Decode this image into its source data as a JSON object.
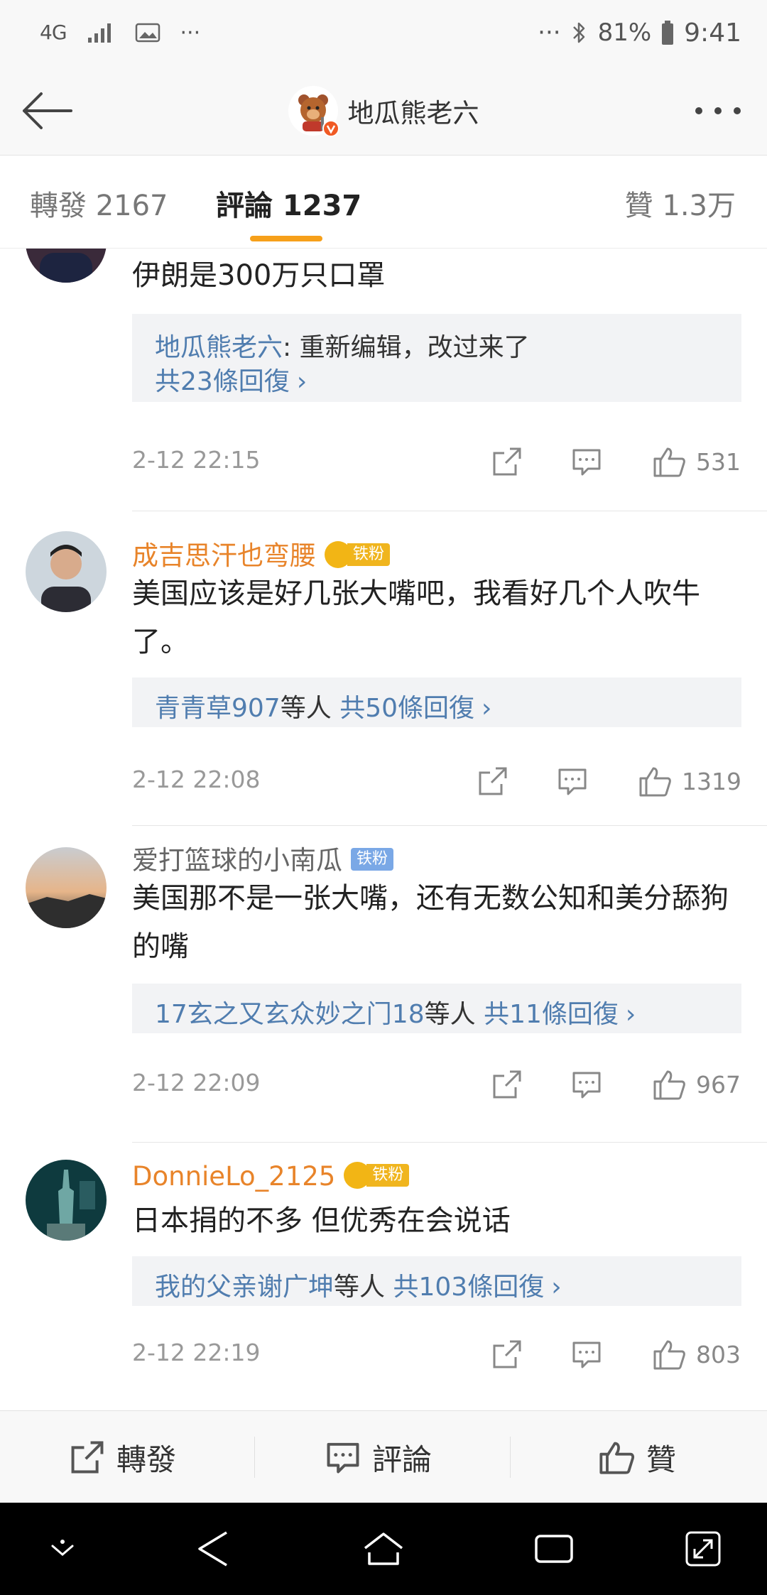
{
  "status_bar": {
    "network": "4G",
    "more": "···",
    "more_right": "···",
    "battery": "81%",
    "time": "9:41"
  },
  "nav": {
    "title": "地瓜熊老六"
  },
  "tabs": {
    "forward_label": "轉發 2167",
    "comment_label": "評論 1237",
    "like_label": "贊 1.3万",
    "active_color": "#f6a01a"
  },
  "comments": [
    {
      "text": "伊朗是300万只口罩",
      "reply_author": "地瓜熊老六",
      "reply_text": ": 重新编辑，改过来了",
      "reply_count": "共23條回復",
      "time": "2-12 22:15",
      "likes": "531"
    },
    {
      "name": "成吉思汗也弯腰",
      "badge": "铁粉",
      "text": "美国应该是好几张大嘴吧，我看好几个人吹牛了。",
      "reply_users": "青青草907",
      "reply_suffix": "等人",
      "reply_count": "共50條回復",
      "time": "2-12 22:08",
      "likes": "1319"
    },
    {
      "name": "爱打篮球的小南瓜",
      "badge": "铁粉",
      "text": "美国那不是一张大嘴，还有无数公知和美分舔狗的嘴",
      "reply_users": "17玄之又玄众妙之门18",
      "reply_suffix": "等人",
      "reply_count": "共11條回復",
      "time": "2-12 22:09",
      "likes": "967"
    },
    {
      "name": "DonnieLo_2125",
      "badge": "铁粉",
      "text": "日本捐的不多 但优秀在会说话",
      "reply_users": "我的父亲谢广坤",
      "reply_suffix": "等人",
      "reply_count": "共103條回復",
      "time": "2-12 22:19",
      "likes": "803"
    }
  ],
  "action_bar": {
    "forward": "轉發",
    "comment": "評論",
    "like": "贊"
  },
  "colors": {
    "name_orange": "#e8842a",
    "link_blue": "#507daf",
    "accent": "#f6a01a"
  }
}
